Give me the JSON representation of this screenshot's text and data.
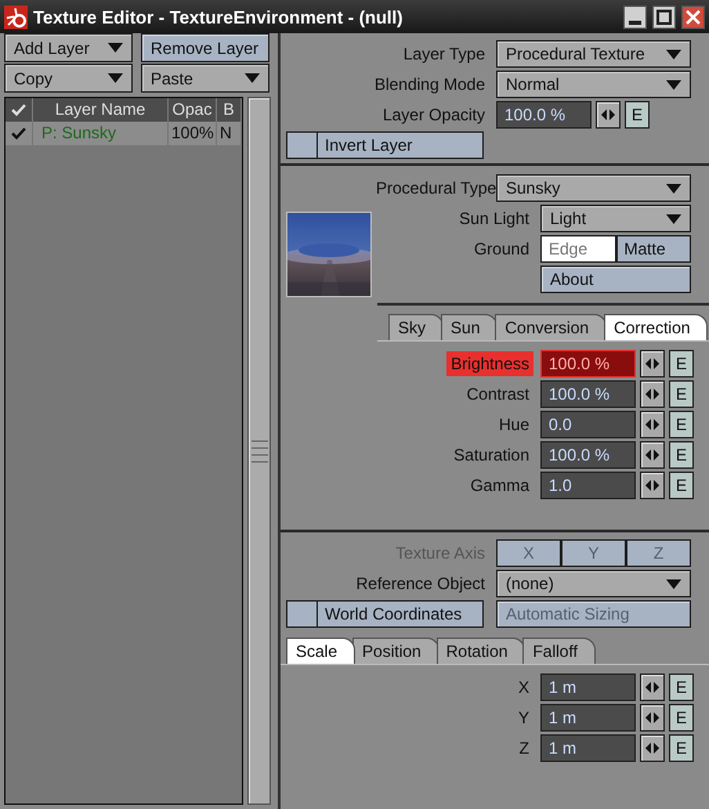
{
  "window": {
    "title": "Texture Editor - TextureEnvironment - (null)"
  },
  "layer_buttons": [
    {
      "label": "Add Layer",
      "kind": "dropdown"
    },
    {
      "label": "Remove Layer",
      "kind": "button"
    },
    {
      "label": "Copy",
      "kind": "dropdown"
    },
    {
      "label": "Paste",
      "kind": "dropdown"
    }
  ],
  "layer_table": {
    "columns": [
      "Layer Name",
      "Opac",
      "B"
    ],
    "rows": [
      {
        "checked": true,
        "name": "P: Sunsky",
        "opacity": "100%",
        "blending": "N"
      }
    ]
  },
  "layer_settings": {
    "layer_type": {
      "label": "Layer Type",
      "value": "Procedural Texture"
    },
    "blending_mode": {
      "label": "Blending Mode",
      "value": "Normal"
    },
    "layer_opacity": {
      "label": "Layer Opacity",
      "value": "100.0 %",
      "envelope": "E",
      "highlighted": false
    },
    "invert_layer": {
      "label": "Invert Layer",
      "checked": false
    }
  },
  "procedural": {
    "procedural_type": {
      "label": "Procedural Type",
      "value": "Sunsky"
    },
    "sun_light": {
      "label": "Sun Light",
      "value": "Light"
    },
    "ground": {
      "label": "Ground",
      "options": [
        {
          "label": "Edge",
          "selected": true
        },
        {
          "label": "Matte",
          "selected": false
        }
      ]
    },
    "about_button": "About",
    "tabs": [
      {
        "label": "Sky",
        "selected": false
      },
      {
        "label": "Sun",
        "selected": false
      },
      {
        "label": "Conversion",
        "selected": false
      },
      {
        "label": "Correction",
        "selected": true
      }
    ],
    "parameters": [
      {
        "label": "Brightness",
        "value": "100.0 %",
        "envelope": "E",
        "highlighted": true
      },
      {
        "label": "Contrast",
        "value": "100.0 %",
        "envelope": "E",
        "highlighted": false
      },
      {
        "label": "Hue",
        "value": "0.0",
        "envelope": "E",
        "highlighted": false
      },
      {
        "label": "Saturation",
        "value": "100.0 %",
        "envelope": "E",
        "highlighted": false
      },
      {
        "label": "Gamma",
        "value": "1.0",
        "envelope": "E",
        "highlighted": false
      }
    ]
  },
  "mapping": {
    "texture_axis": {
      "label": "Texture Axis",
      "disabled": true,
      "options": [
        {
          "label": "X",
          "selected": false
        },
        {
          "label": "Y",
          "selected": false
        },
        {
          "label": "Z",
          "selected": false
        }
      ]
    },
    "reference_object": {
      "label": "Reference Object",
      "value": "(none)"
    },
    "world_coordinates": {
      "label": "World Coordinates",
      "checked": false
    },
    "automatic_sizing": {
      "label": "Automatic Sizing",
      "disabled": true
    },
    "tabs": [
      {
        "label": "Scale",
        "selected": true
      },
      {
        "label": "Position",
        "selected": false
      },
      {
        "label": "Rotation",
        "selected": false
      },
      {
        "label": "Falloff",
        "selected": false
      }
    ],
    "values": [
      {
        "label": "X",
        "value": "1 m",
        "envelope": "E",
        "highlighted": false
      },
      {
        "label": "Y",
        "value": "1 m",
        "envelope": "E",
        "highlighted": false
      },
      {
        "label": "Z",
        "value": "1 m",
        "envelope": "E",
        "highlighted": false
      }
    ]
  }
}
